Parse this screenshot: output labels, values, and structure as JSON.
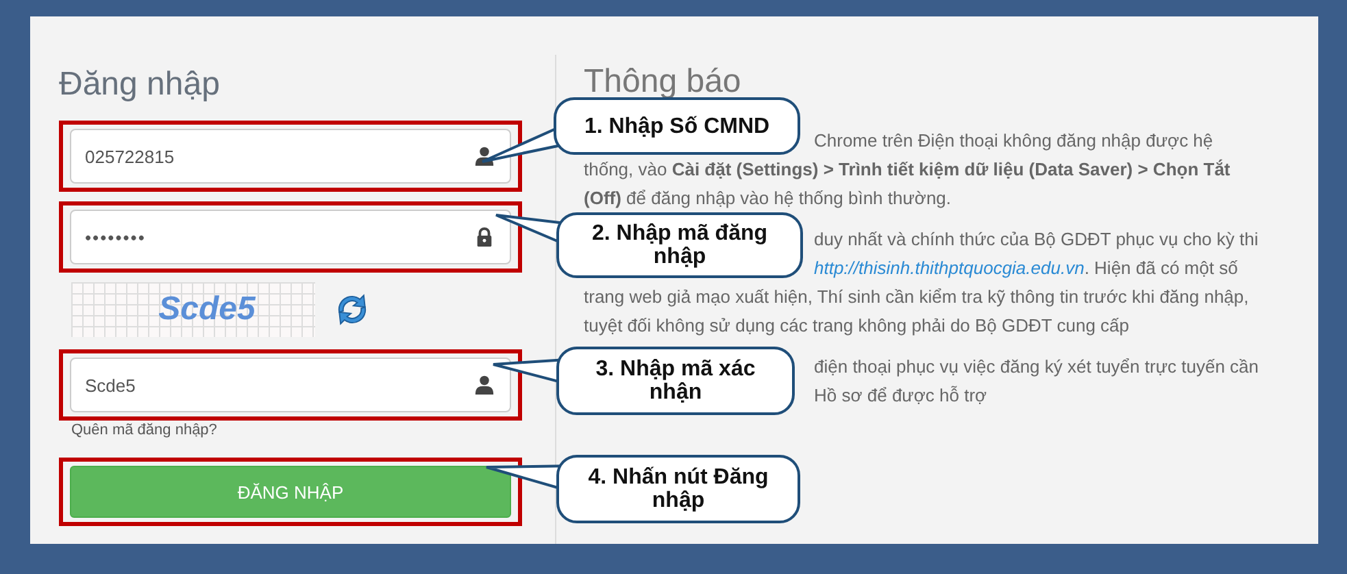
{
  "login": {
    "title": "Đăng nhập",
    "fields": [
      {
        "kind": "text",
        "value": "025722815"
      },
      {
        "kind": "password",
        "value": "••••••••"
      }
    ],
    "captcha": {
      "code": "Scde5"
    },
    "captcha_field": {
      "kind": "text",
      "value": "Scde5"
    },
    "forgot_link": "Quên mã đăng nhập?",
    "button": "ĐĂNG NHẬP"
  },
  "notice": {
    "title": "Thông báo",
    "paragraphs": [
      {
        "lines": [
          {
            "kind": "partial",
            "text": "Chrome trên Điện thoại không đăng nhập được hệ"
          },
          {
            "kind": "full",
            "text": "thống, vào **Cài đặt (Settings) > Trình tiết kiệm dữ liệu (Data Saver) > Chọn Tắt**"
          },
          {
            "kind": "full",
            "text": "**(Off)** để đăng nhập vào hệ thống bình thường."
          }
        ]
      },
      {
        "lines": [
          {
            "kind": "partial",
            "text": "duy nhất và chính thức của Bộ GDĐT phục vụ cho kỳ thi"
          },
          {
            "kind": "partial-link",
            "text": "http://thisinh.thithptquocgia.edu.vn",
            "after": ". Hiện đã có một số"
          },
          {
            "kind": "full",
            "text": "trang web giả mạo xuất hiện, Thí sinh cần kiểm tra kỹ thông tin trước khi đăng nhập,"
          },
          {
            "kind": "full",
            "text": "tuyệt đối không sử dụng các trang không phải do Bộ GDĐT cung cấp"
          }
        ]
      },
      {
        "lines": [
          {
            "kind": "partial",
            "text": "điện thoại phục vụ việc đăng ký xét tuyển trực tuyến cần"
          },
          {
            "kind": "partial",
            "text": "Hồ sơ để được hỗ trợ"
          }
        ]
      }
    ]
  },
  "callouts": [
    {
      "text": "1. Nhập Số CMND"
    },
    {
      "text": "2. Nhập mã đăng nhập"
    },
    {
      "text": "3. Nhập mã xác nhận"
    },
    {
      "text": "4. Nhấn nút Đăng nhập"
    }
  ]
}
